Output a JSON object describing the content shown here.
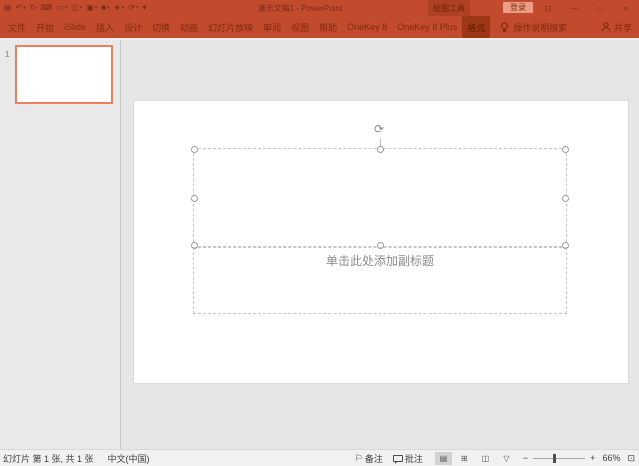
{
  "titlebar": {
    "title": "演示文稿1 - PowerPoint",
    "contextual_group": "绘图工具",
    "sign_in": "登录",
    "qat": [
      {
        "name": "save-icon",
        "glyph": "▤"
      },
      {
        "name": "undo-icon",
        "glyph": "↶",
        "caret": "▾"
      },
      {
        "name": "redo-icon",
        "glyph": "↻"
      },
      {
        "name": "keyboard-icon",
        "glyph": "⌨"
      },
      {
        "name": "new-slide-icon",
        "glyph": "▭",
        "caret": "▾"
      },
      {
        "name": "layout-icon",
        "glyph": "◫",
        "caret": "▾"
      },
      {
        "name": "shapes-icon",
        "glyph": "▣",
        "caret": "▾"
      },
      {
        "name": "fill-icon",
        "glyph": "■",
        "caret": "▾"
      },
      {
        "name": "star-icon",
        "glyph": "★",
        "caret": "▾"
      },
      {
        "name": "reset-icon",
        "glyph": "⟳",
        "caret": "▾"
      },
      {
        "name": "qat-overflow-chevron",
        "glyph": "▾"
      }
    ],
    "window_controls": {
      "ribbon_options": "⊡",
      "minimize": "—",
      "maximize": "□",
      "close": "×"
    }
  },
  "ribbon": {
    "tabs": [
      "文件",
      "开始",
      "iSlide",
      "插入",
      "设计",
      "切换",
      "动画",
      "幻灯片放映",
      "审阅",
      "视图",
      "帮助",
      "OneKey 8",
      "OneKey 8 Plus"
    ],
    "contextual_tab": "格式",
    "tell_me": "操作说明搜索",
    "share": "共享"
  },
  "slides_panel": {
    "slide_number": "1"
  },
  "canvas": {
    "subtitle_prompt": "单击此处添加副标题",
    "rotation_glyph": "⟳"
  },
  "statusbar": {
    "slide_info": "幻灯片 第 1 张, 共 1 张",
    "language": "中文(中国)",
    "notes": "备注",
    "notes_icon": "⚐",
    "comments": "批注",
    "view_icons": [
      "▤",
      "⊞",
      "◫",
      "▽"
    ],
    "zoom_out": "−",
    "zoom_in": "+",
    "zoom_percent": "66%",
    "fit_icon": "⊡"
  },
  "colors": {
    "chrome": "#c24b2d",
    "contextual_group_bg": "#ad4123",
    "format_tab_bg": "#9d3715",
    "chrome_text": "#7f2b11",
    "signin_bg": "#ec9d84",
    "selection_accent": "#e97f5f"
  }
}
